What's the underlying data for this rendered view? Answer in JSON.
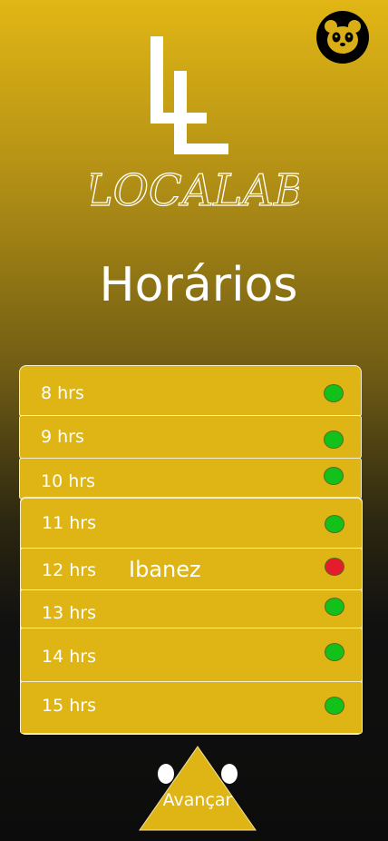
{
  "header": {
    "avatar_icon": "panda-icon",
    "logo_mark": "LL",
    "logo_text": "LOCALAB"
  },
  "page": {
    "title": "Horários"
  },
  "slots": [
    {
      "label": "8 hrs",
      "status": "available",
      "name": ""
    },
    {
      "label": "9 hrs",
      "status": "available",
      "name": ""
    },
    {
      "label": "10 hrs",
      "status": "available",
      "name": ""
    },
    {
      "label": "11 hrs",
      "status": "available",
      "name": ""
    },
    {
      "label": "12 hrs",
      "status": "booked",
      "name": "Ibanez"
    },
    {
      "label": "13 hrs",
      "status": "available",
      "name": ""
    },
    {
      "label": "14 hrs",
      "status": "available",
      "name": ""
    },
    {
      "label": "15 hrs",
      "status": "available",
      "name": ""
    }
  ],
  "colors": {
    "accent": "#dfb516",
    "available": "#12c21a",
    "booked": "#e51c2c"
  },
  "footer": {
    "next_label": "Avançar"
  }
}
